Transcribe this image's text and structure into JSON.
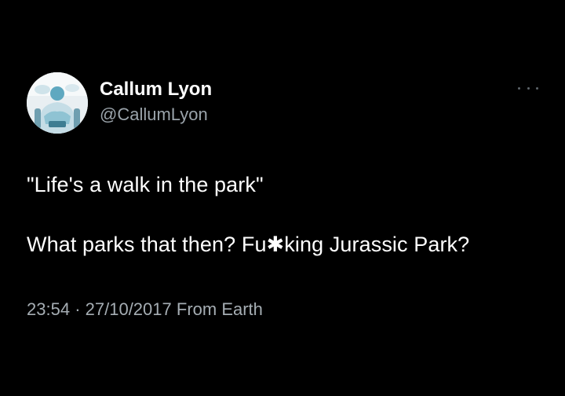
{
  "user": {
    "display_name": "Callum Lyon",
    "handle": "@CallumLyon",
    "avatar_icon": "user-avatar"
  },
  "menu": {
    "icon": "more-icon"
  },
  "tweet": {
    "line1": "\"Life's a walk in the park\"",
    "line2": "What parks that then? Fu✱king Jurassic Park?"
  },
  "meta": {
    "time": "23:54",
    "separator": "·",
    "date": "27/10/2017",
    "source": "From Earth"
  },
  "colors": {
    "background": "#000000",
    "text": "#ffffff",
    "secondary_text": "#9aa3aa"
  }
}
